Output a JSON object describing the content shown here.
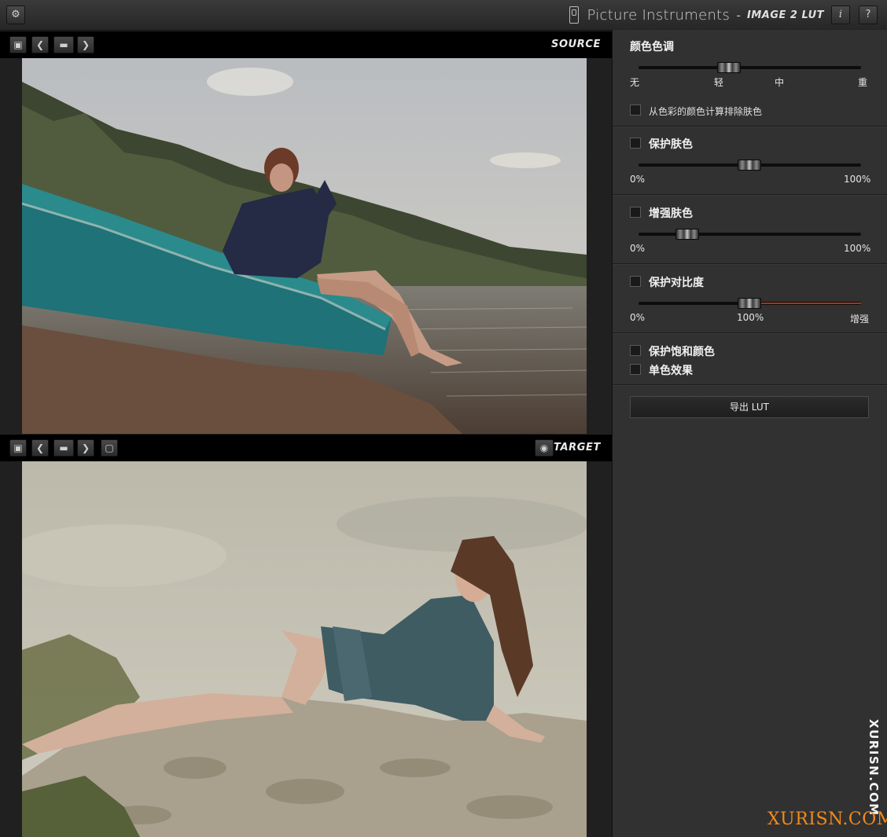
{
  "titlebar": {
    "brand_name": "Picture Instruments",
    "brand_separator": "-",
    "product_name": "IMAGE 2 LUT",
    "settings_icon": "gear-icon",
    "info_label": "i",
    "help_label": "?"
  },
  "source_panel": {
    "label": "SOURCE",
    "tools": [
      "load-icon",
      "previous-icon",
      "folder-icon",
      "next-icon"
    ],
    "photo": "woman in hoodie seated in a teal rowboat at a lakeshore, forest behind"
  },
  "target_panel": {
    "label": "TARGET",
    "tools": [
      "load-icon",
      "previous-icon",
      "folder-icon",
      "next-icon",
      "save-icon"
    ],
    "eye_icon": "eye-icon",
    "photo": "woman in teal dress reclining on rocks under a cloudy sky"
  },
  "settings": {
    "color_tone": {
      "title": "颜色色调",
      "ticks": [
        "无",
        "轻",
        "中",
        "重"
      ],
      "slider_value": 0.4,
      "exclude_skin_label": "从色彩的颜色计算排除肤色",
      "exclude_skin_checked": false
    },
    "protect_skin": {
      "label": "保护肤色",
      "checked": false,
      "min": "0%",
      "max": "100%",
      "slider_value": 0.5
    },
    "enhance_skin": {
      "label": "增强肤色",
      "checked": false,
      "min": "0%",
      "max": "100%",
      "slider_value": 0.22
    },
    "protect_contrast": {
      "label": "保护对比度",
      "checked": false,
      "min": "0%",
      "mid": "100%",
      "max": "增强",
      "slider_value": 0.5
    },
    "protect_saturation": {
      "label": "保护饱和颜色",
      "checked": false
    },
    "monochrome": {
      "label": "单色效果",
      "checked": false
    },
    "export_button": "导出 LUT"
  },
  "watermark": {
    "vertical": "XURISN.COM",
    "horizontal": "XURISN.COM"
  },
  "colors": {
    "accent_red": "#a8331c",
    "watermark_orange": "#f28a1a"
  }
}
